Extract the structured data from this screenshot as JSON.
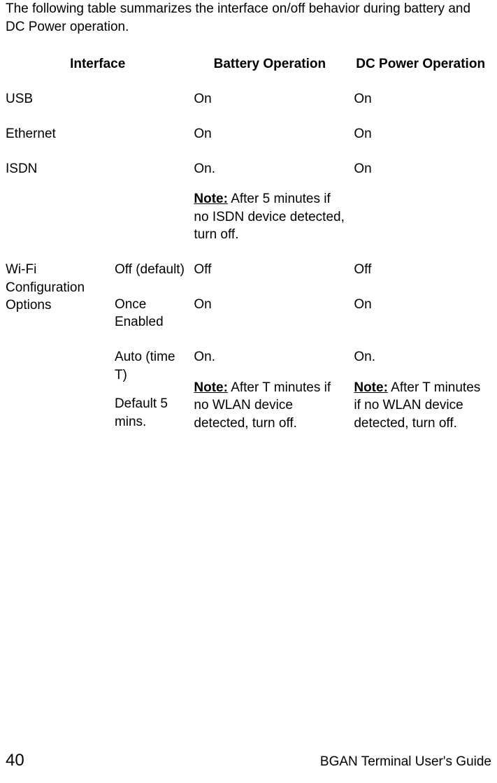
{
  "intro": "The following table summarizes the interface on/off behavior during battery and DC Power operation.",
  "headers": {
    "interface": "Interface",
    "battery": "Battery Operation",
    "dcpower": "DC Power Operation"
  },
  "rows": {
    "usb": {
      "name": "USB",
      "battery": "On",
      "dc": "On"
    },
    "ethernet": {
      "name": "Ethernet",
      "battery": "On",
      "dc": "On"
    },
    "isdn": {
      "name": "ISDN",
      "battery_on": "On.",
      "note_label": "Note:",
      "note_text": "  After 5 minutes if no ISDN device detected, turn off.",
      "dc": "On"
    },
    "wifi": {
      "name": "Wi-Fi Configuration Options",
      "option1": {
        "label": "Off (default)",
        "battery": "Off",
        "dc": "Off"
      },
      "option2": {
        "label": "Once Enabled",
        "battery": "On",
        "dc": "On"
      },
      "option3": {
        "label_line1": "Auto (time T)",
        "label_line2": "Default 5 mins.",
        "battery_on": "On.",
        "battery_note_label": "Note:",
        "battery_note_text": "  After T minutes if no WLAN device detected, turn off.",
        "dc_on": "On.",
        "dc_note_label": "Note:",
        "dc_note_text": "  After T minutes if no WLAN device detected, turn off."
      }
    }
  },
  "footer": {
    "page": "40",
    "title": "BGAN Terminal User's Guide"
  }
}
